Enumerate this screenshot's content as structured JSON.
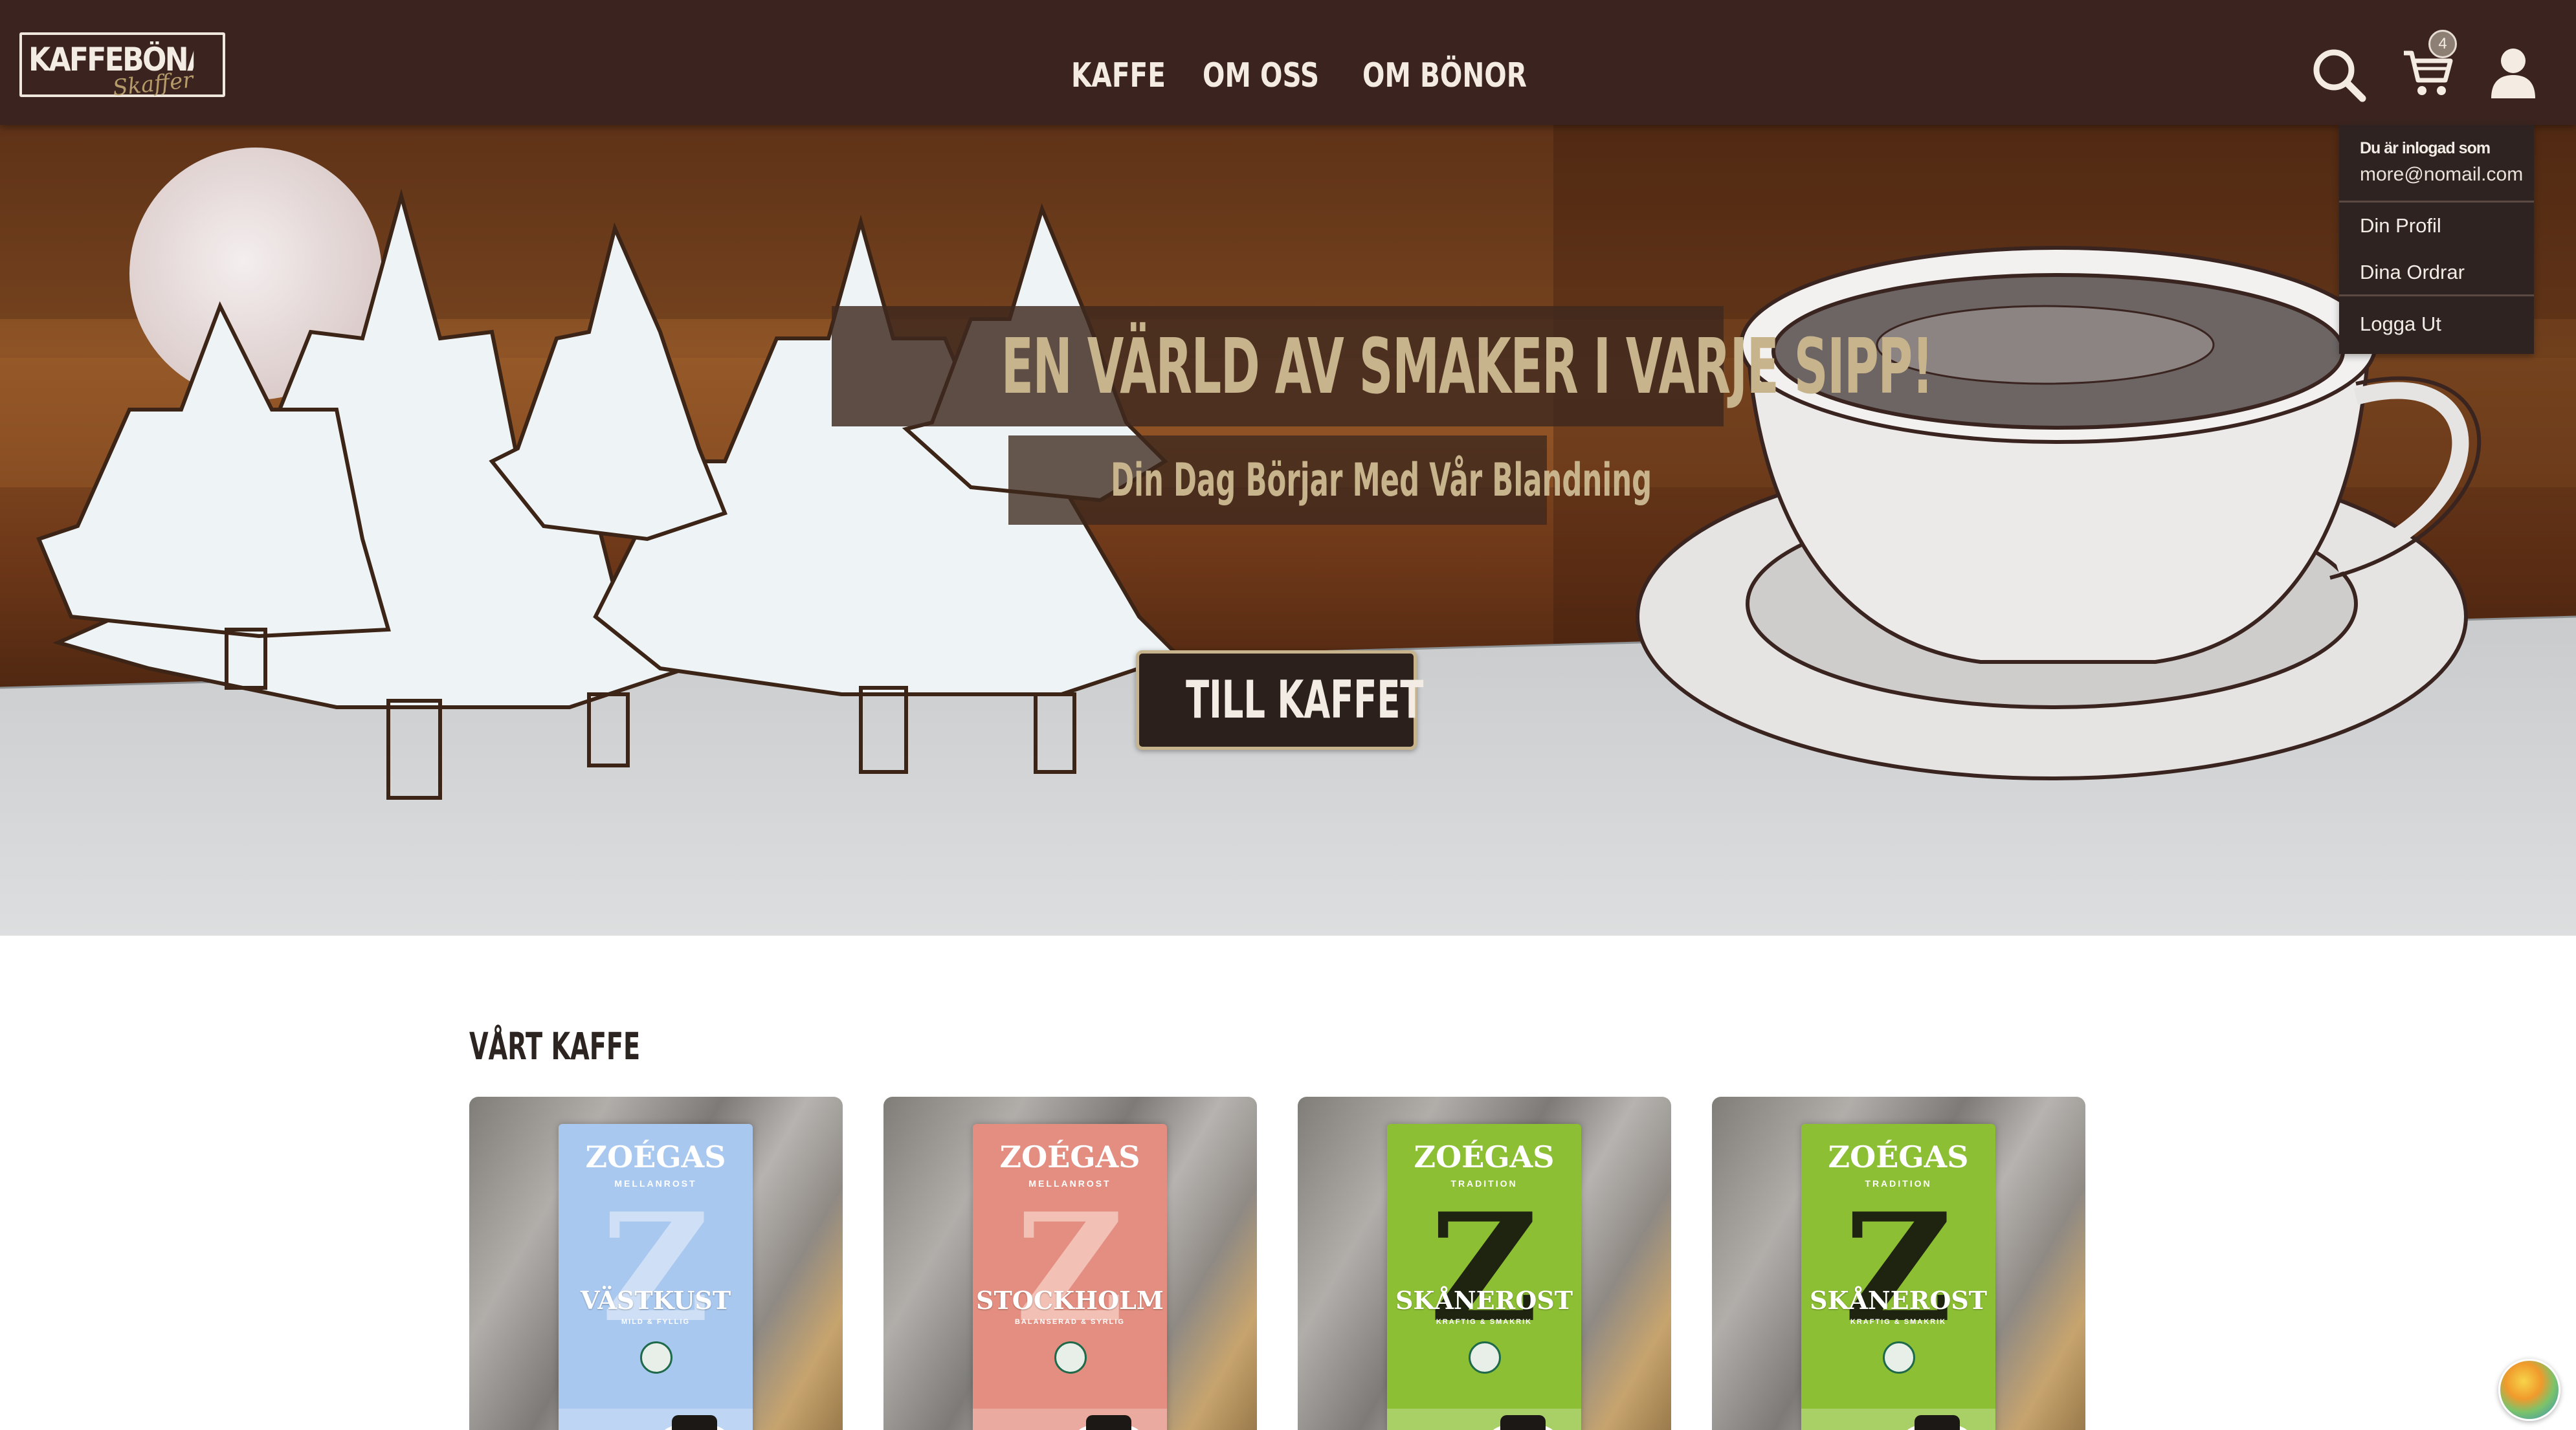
{
  "brand": {
    "logo_text": "KAFFEBÖNANS",
    "logo_script": "Skaffer",
    "colors": {
      "nav_bg": "#3b2420",
      "accent": "#c8b48c",
      "cta_bg": "#2c201d"
    }
  },
  "nav": {
    "links": [
      "KAFFE",
      "OM OSS",
      "OM BÖNOR"
    ],
    "cart_count": "4",
    "icons": [
      "search-icon",
      "cart-icon",
      "user-icon"
    ]
  },
  "user_menu": {
    "header": "Du är inlogad som",
    "email": "more@nomail.com",
    "items": [
      "Din Profil",
      "Dina Ordrar"
    ],
    "logout": "Logga Ut"
  },
  "hero": {
    "title": "EN VÄRLD AV SMAKER I VARJE SIPP!",
    "subtitle": "Din Dag Börjar Med Vår Blandning",
    "cta": "TILL KAFFET"
  },
  "products_section": {
    "title": "VÅRT KAFFE",
    "products": [
      {
        "brand": "ZOÉGAS",
        "line": "MELLANROST",
        "name": "VÄSTKUST",
        "desc": "MILD & FYLLIG",
        "color": "#a9c8ef",
        "z_color": "#cfe0f6"
      },
      {
        "brand": "ZOÉGAS",
        "line": "MELLANROST",
        "name": "STOCKHOLM",
        "desc": "BALANSERAD & SYRLIG",
        "color": "#e38e80",
        "z_color": "#f2c0b5"
      },
      {
        "brand": "ZOÉGAS",
        "line": "TRADITION",
        "name": "SKÅNEROST",
        "desc": "KRAFTIG & SMAKRIK",
        "color": "#8dbf34",
        "z_color": "#1e2410"
      },
      {
        "brand": "ZOÉGAS",
        "line": "TRADITION",
        "name": "SKÅNEROST",
        "desc": "KRAFTIG & SMAKRIK",
        "color": "#8dbf34",
        "z_color": "#1e2410"
      }
    ]
  }
}
